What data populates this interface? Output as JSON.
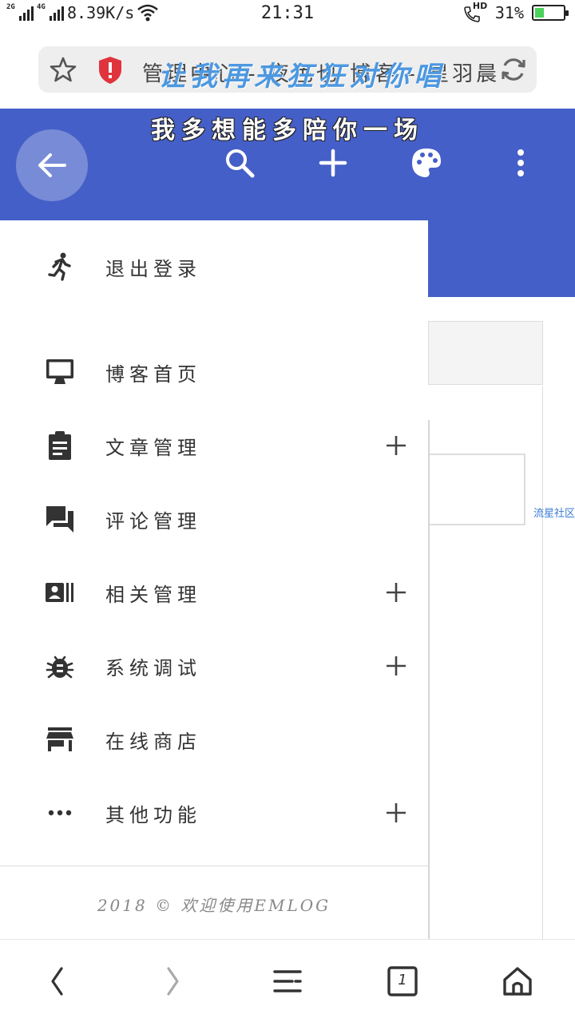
{
  "status_bar": {
    "network_1": "2G",
    "network_2": "4G",
    "speed": "8.39K/s",
    "time": "21:31",
    "hd": "HD",
    "battery_text": "31%",
    "battery_level": 0.31
  },
  "browser": {
    "url_text": "管理中心 - 夜色也 博客 - 星羽晨",
    "overlay_text": "让我再来狂狂对你唱",
    "icons": [
      "star-icon",
      "shield-icon",
      "refresh-icon"
    ]
  },
  "header": {
    "lyric": "我多想能多陪你一场",
    "icons": [
      "back-arrow-icon",
      "search-icon",
      "add-icon",
      "palette-icon",
      "more-vert-icon"
    ],
    "color": "#455fc8"
  },
  "drawer": {
    "items": [
      {
        "label": "退出登录",
        "icon": "run-icon",
        "expandable": false
      },
      {
        "label": "博客首页",
        "icon": "monitor-icon",
        "expandable": false
      },
      {
        "label": "文章管理",
        "icon": "clipboard-icon",
        "expandable": true
      },
      {
        "label": "评论管理",
        "icon": "forum-icon",
        "expandable": true
      },
      {
        "label": "相关管理",
        "icon": "contact-card-icon",
        "expandable": true
      },
      {
        "label": "系统调试",
        "icon": "bug-icon",
        "expandable": true
      },
      {
        "label": "在线商店",
        "icon": "store-icon",
        "expandable": false
      },
      {
        "label": "其他功能",
        "icon": "more-horiz-icon",
        "expandable": true
      }
    ],
    "footer": "2018 © 欢迎使用EMLOG"
  },
  "background": {
    "link": "流星社区"
  },
  "bottom_nav": {
    "tab_count": "1",
    "icons": [
      "back-icon",
      "forward-icon",
      "menu-icon",
      "tabs-icon",
      "home-icon"
    ]
  }
}
